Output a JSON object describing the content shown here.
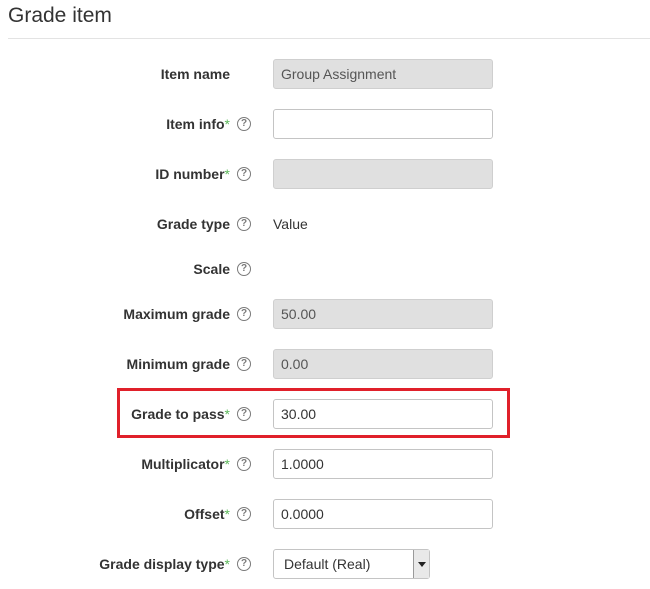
{
  "section": {
    "title": "Grade item"
  },
  "help_glyph": "?",
  "required_mark": "*",
  "fields": {
    "item_name": {
      "label": "Item name",
      "value": "Group Assignment"
    },
    "item_info": {
      "label": "Item info",
      "value": ""
    },
    "id_number": {
      "label": "ID number",
      "value": ""
    },
    "grade_type": {
      "label": "Grade type",
      "value": "Value"
    },
    "scale": {
      "label": "Scale"
    },
    "maximum_grade": {
      "label": "Maximum grade",
      "value": "50.00"
    },
    "minimum_grade": {
      "label": "Minimum grade",
      "value": "0.00"
    },
    "grade_to_pass": {
      "label": "Grade to pass",
      "value": "30.00"
    },
    "multiplicator": {
      "label": "Multiplicator",
      "value": "1.0000"
    },
    "offset": {
      "label": "Offset",
      "value": "0.0000"
    },
    "grade_display_type": {
      "label": "Grade display type",
      "selected": "Default (Real)"
    }
  },
  "colors": {
    "required": "#5cb85c",
    "highlight": "#e0202a",
    "disabled_bg": "#e0e0e0"
  },
  "icons": {
    "help": "question-circle-icon",
    "dropdown": "chevron-down-icon"
  }
}
